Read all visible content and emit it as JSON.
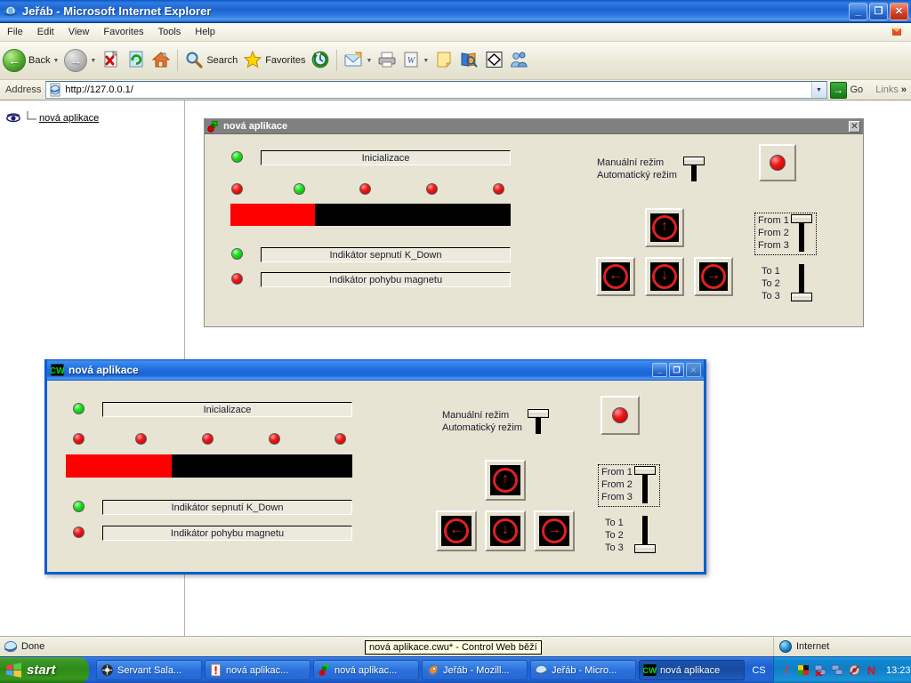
{
  "browser": {
    "title": "Jeřáb - Microsoft Internet Explorer",
    "icon": "ie-icon",
    "window_buttons": {
      "minimize": "_",
      "maximize": "❐",
      "close": "✕"
    },
    "menu": [
      "File",
      "Edit",
      "View",
      "Favorites",
      "Tools",
      "Help"
    ],
    "toolbar": {
      "back_label": "Back",
      "search_label": "Search",
      "favorites_label": "Favorites",
      "icons": [
        "back-icon",
        "forward-icon",
        "stop-icon",
        "refresh-icon",
        "home-icon",
        "search-icon",
        "favorites-icon",
        "history-icon",
        "mail-icon",
        "print-icon",
        "edit-word-icon",
        "notes-icon",
        "research-icon",
        "diamond-icon",
        "messenger-icon"
      ]
    },
    "address": {
      "label": "Address",
      "value": "http://127.0.0.1/",
      "placeholder": "http://",
      "go_label": "Go",
      "links_label": "Links",
      "chevron": "»"
    }
  },
  "page": {
    "tree": {
      "icon": "eye-icon",
      "link_label": "nová aplikace"
    }
  },
  "embedded_panel": {
    "title": "nová aplikace",
    "icon": "cw-icon",
    "close_label": "✕",
    "leds": {
      "init": "green",
      "row": [
        "red",
        "green",
        "red",
        "red",
        "red"
      ],
      "k_down": "green",
      "magnet": "red"
    },
    "fields": {
      "init": "Inicializace",
      "k_down": "Indikátor sepnutí K_Down",
      "magnet": "Indikátor pohybu magnetu"
    },
    "progress": {
      "percent": 30,
      "fill_color": "#ff0000",
      "track_color": "#000000"
    },
    "mode": {
      "manual": "Manuální režim",
      "automatic": "Automatický režim",
      "position": "top"
    },
    "lamp": {
      "color": "red"
    },
    "from_selector": {
      "options": [
        "From 1",
        "From 2",
        "From 3"
      ],
      "position": "top"
    },
    "to_selector": {
      "options": [
        "To 1",
        "To 2",
        "To 3"
      ],
      "position": "bottom"
    },
    "arrows": {
      "up": "↑",
      "left": "←",
      "down": "↓",
      "right": "→"
    }
  },
  "floating_window": {
    "title": "nová aplikace",
    "icon": "cw-icon",
    "window_buttons": {
      "minimize": "_",
      "maximize": "❐",
      "close": "✕"
    },
    "leds": {
      "init": "green",
      "row": [
        "red",
        "red",
        "red",
        "red",
        "red"
      ],
      "k_down": "green",
      "magnet": "red"
    },
    "fields": {
      "init": "Inicializace",
      "k_down": "Indikátor sepnutí K_Down",
      "magnet": "Indikátor pohybu magnetu"
    },
    "progress": {
      "percent": 37,
      "fill_color": "#ff0000",
      "track_color": "#000000"
    },
    "mode": {
      "manual": "Manuální režim",
      "automatic": "Automatický režim",
      "position": "top"
    },
    "lamp": {
      "color": "red"
    },
    "from_selector": {
      "options": [
        "From 1",
        "From 2",
        "From 3"
      ],
      "position": "top"
    },
    "to_selector": {
      "options": [
        "To 1",
        "To 2",
        "To 3"
      ],
      "position": "bottom"
    },
    "arrows": {
      "up": "↑",
      "left": "←",
      "down": "↓",
      "right": "→"
    }
  },
  "tooltip": {
    "text": "nová aplikace.cwu* - Control Web běží"
  },
  "statusbar": {
    "text": "Done",
    "zone": "Internet",
    "zone_icon": "globe-icon"
  },
  "taskbar": {
    "start_label": "start",
    "buttons": [
      {
        "label": "Servant Sala...",
        "icon": "servant-icon",
        "active": false
      },
      {
        "label": "nová aplikac...",
        "icon": "alert-icon",
        "active": false
      },
      {
        "label": "nová aplikac...",
        "icon": "cw-red-icon",
        "active": false
      },
      {
        "label": "Jeřáb - Mozill...",
        "icon": "firefox-icon",
        "active": false
      },
      {
        "label": "Jeřáb - Micro...",
        "icon": "ie-icon",
        "active": false
      },
      {
        "label": "nová aplikace",
        "icon": "cw-icon",
        "active": true
      }
    ],
    "language": "CS",
    "tray_icons": [
      "java-icon",
      "colors-icon",
      "network-disconnected-icon",
      "network-icon",
      "volume-muted-icon",
      "norton-icon"
    ],
    "clock": "13:23"
  }
}
